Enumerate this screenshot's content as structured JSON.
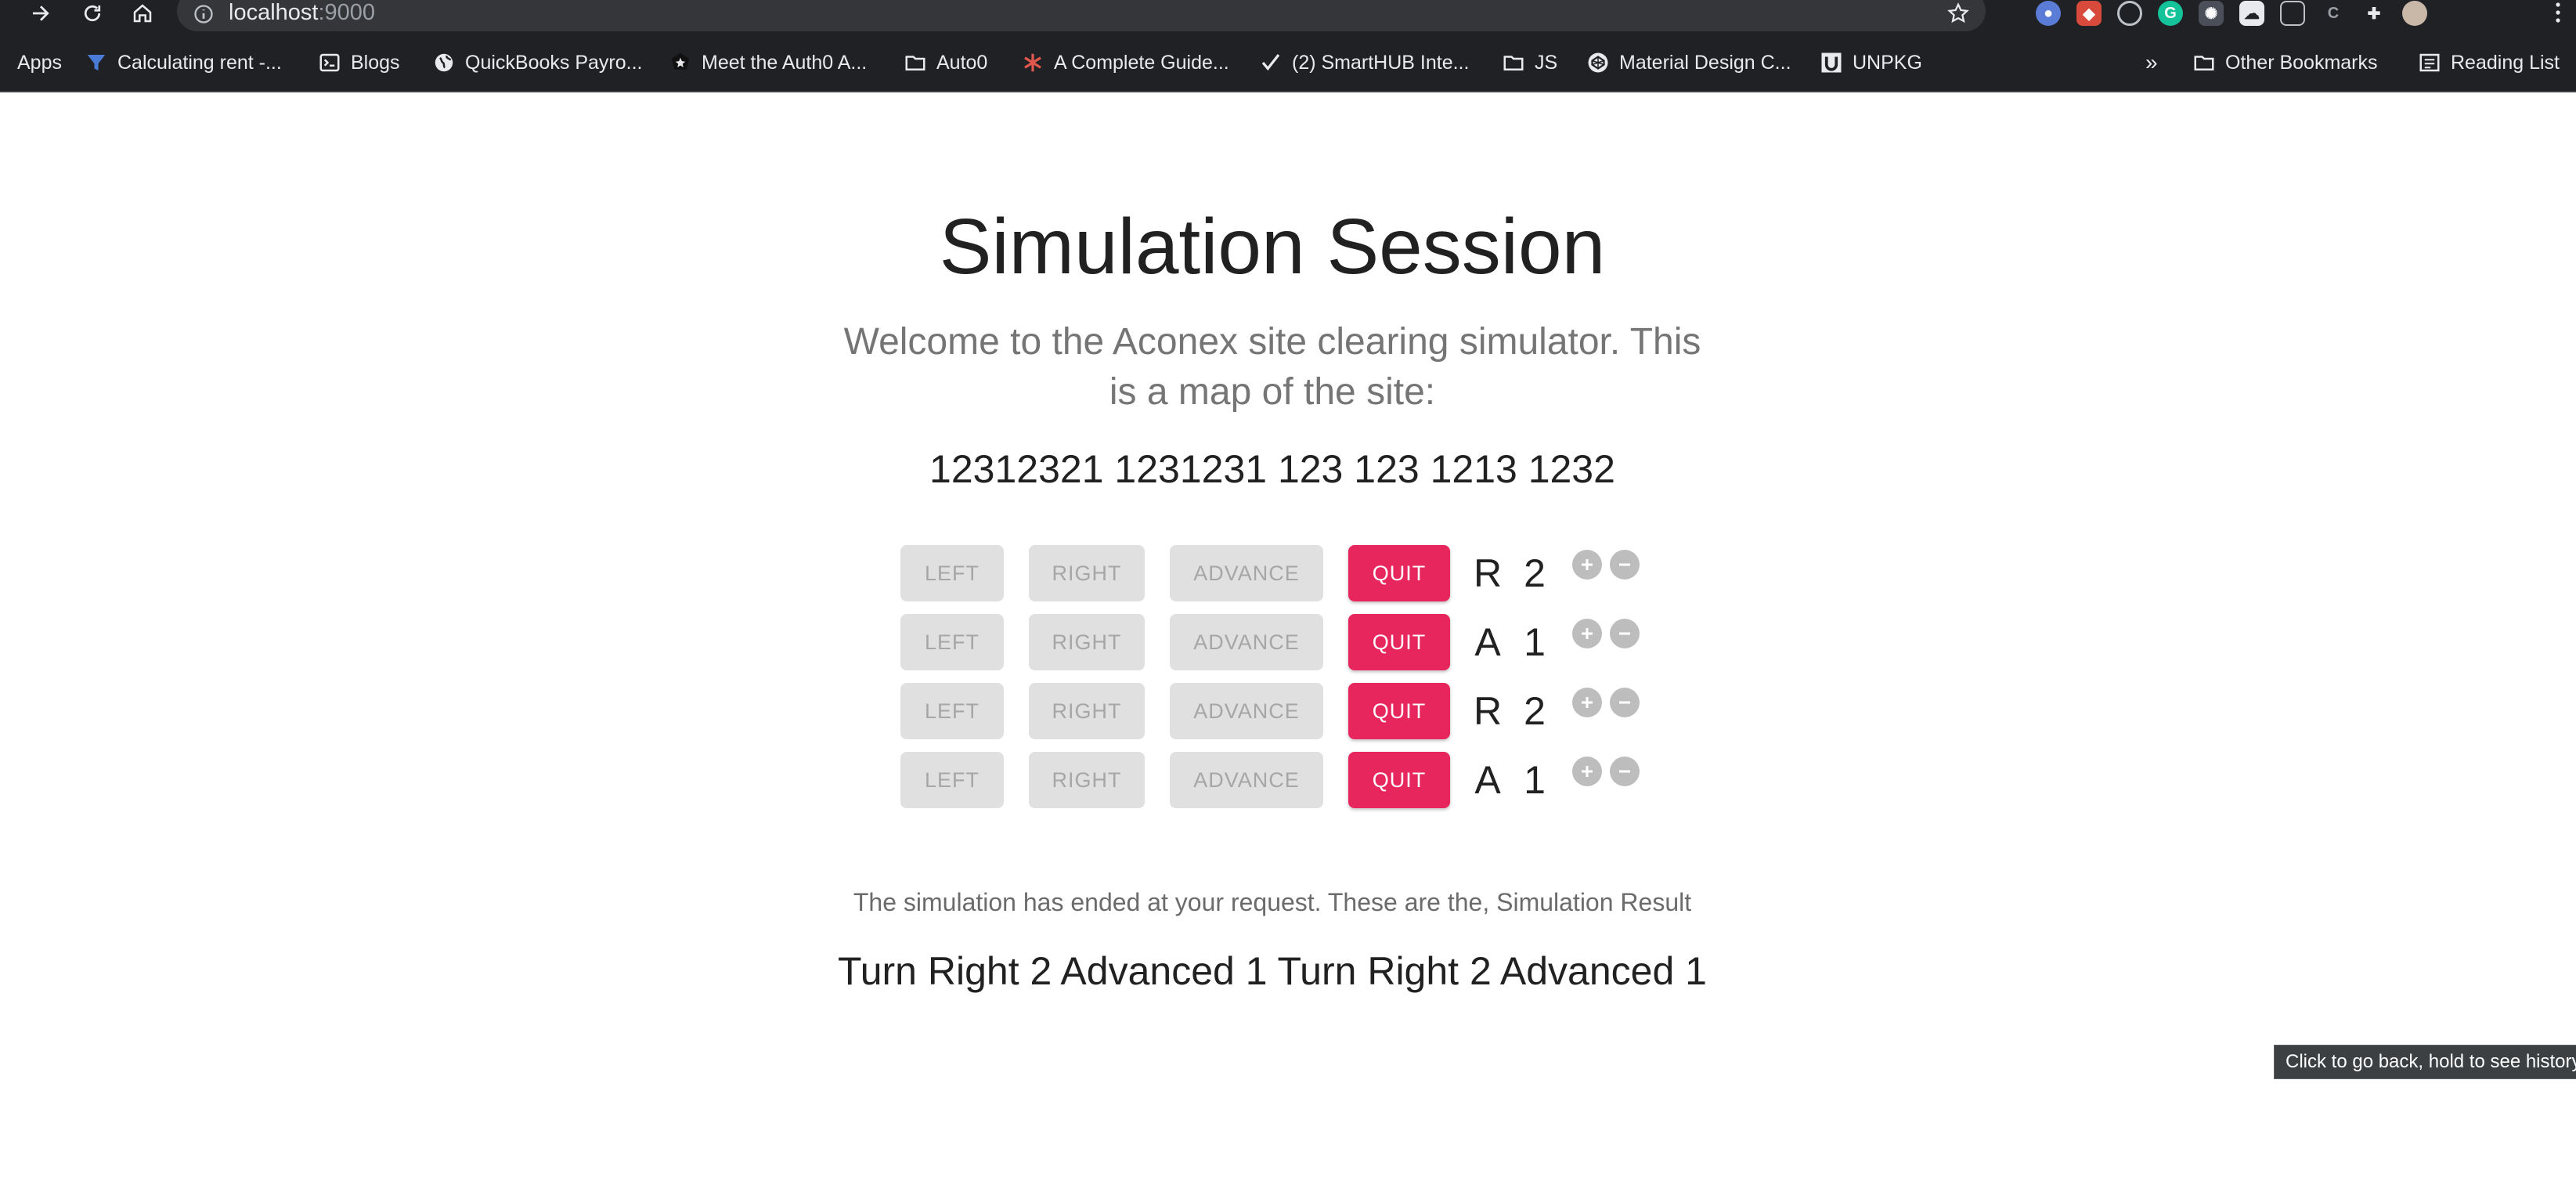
{
  "browser": {
    "url_host": "localhost",
    "url_port": ":9000",
    "bookmarks": [
      {
        "label": "Apps",
        "icon": "apps-grid-icon"
      },
      {
        "label": "Calculating rent -...",
        "icon": "funnel-icon"
      },
      {
        "label": "Blogs",
        "icon": "terminal-icon"
      },
      {
        "label": "QuickBooks Payro...",
        "icon": "globe-icon"
      },
      {
        "label": "Meet the Auth0 A...",
        "icon": "auth0-icon"
      },
      {
        "label": "Auto0",
        "icon": "folder-icon"
      },
      {
        "label": "A Complete Guide...",
        "icon": "asterisk-icon"
      },
      {
        "label": "(2) SmartHUB Inte...",
        "icon": "checkmark-icon"
      },
      {
        "label": "JS",
        "icon": "folder-icon"
      },
      {
        "label": "Material Design C...",
        "icon": "codepen-icon"
      },
      {
        "label": "UNPKG",
        "icon": "unpkg-icon"
      }
    ],
    "overflow_label": "»",
    "other_bookmarks": "Other Bookmarks",
    "reading_list": "Reading List",
    "tooltip": "Click to go back, hold to see history"
  },
  "page": {
    "title": "Simulation Session",
    "intro": "Welcome to the Aconex site clearing simulator. This is a map of the site:",
    "site_map": "12312321 1231231 123 123 1213 1232",
    "buttons": {
      "left": "LEFT",
      "right": "RIGHT",
      "advance": "ADVANCE",
      "quit": "QUIT"
    },
    "commands": [
      {
        "letter": "R",
        "count": "2"
      },
      {
        "letter": "A",
        "count": "1"
      },
      {
        "letter": "R",
        "count": "2"
      },
      {
        "letter": "A",
        "count": "1"
      }
    ],
    "end_message": "The simulation has ended at your request. These are the, Simulation Result",
    "result": "Turn Right 2 Advanced 1 Turn Right 2 Advanced 1"
  },
  "colors": {
    "quit_button": "#e8265e",
    "disabled_button": "#e0e0e0",
    "chrome_background": "#202124"
  }
}
